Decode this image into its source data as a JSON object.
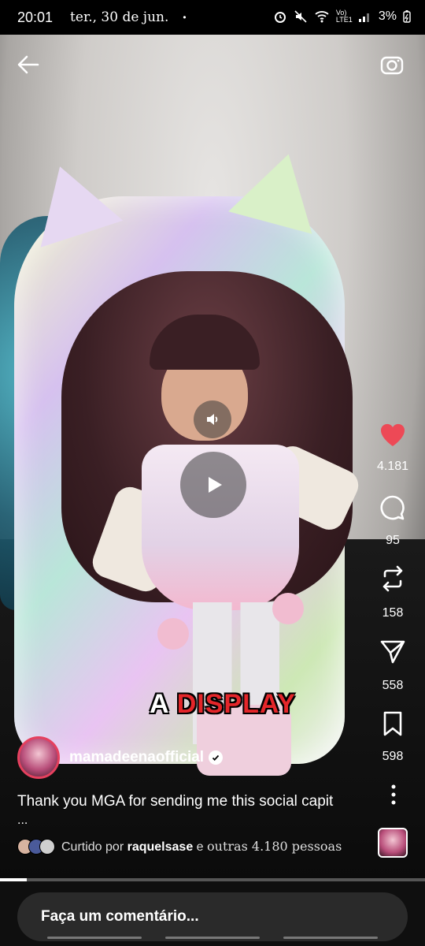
{
  "status_bar": {
    "time": "20:01",
    "date": "ter., 30 de jun.",
    "dot": "•",
    "network": "Vo) LTE1",
    "battery": "3%"
  },
  "post": {
    "overlay_text_1": "A",
    "overlay_text_2": "DISPLAY",
    "author": "mamadeenaofficial",
    "caption": "Thank you MGA for sending me this social capit",
    "caption_more": "...",
    "liked_prefix": "Curtido por",
    "liked_user": "raquelsase",
    "liked_connector": "e",
    "liked_others": "outras 4.180 pessoas"
  },
  "actions": {
    "likes": "4.181",
    "comments": "95",
    "reposts": "158",
    "shares": "558",
    "saves": "598"
  },
  "progress_fraction": 0.063,
  "comment_placeholder": "Faça um comentário...",
  "colors": {
    "like_red": "#ed4956",
    "overlay_red": "#e4262a",
    "avatar_ring": "#e5405e"
  }
}
